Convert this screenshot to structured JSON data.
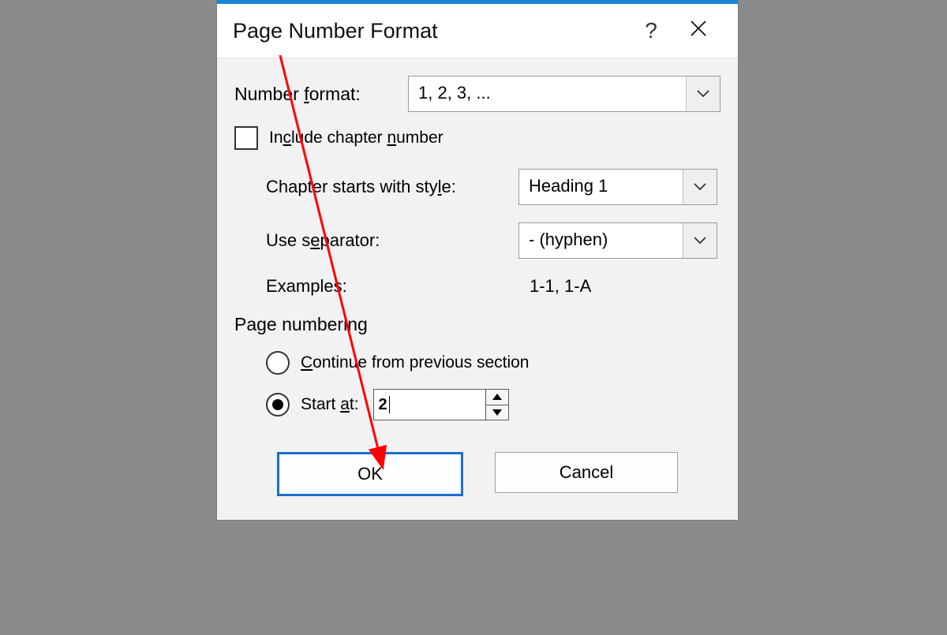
{
  "dialog": {
    "title": "Page Number Format",
    "number_format_label_prefix": "Number ",
    "number_format_label_u": "f",
    "number_format_label_suffix": "ormat:",
    "number_format_value": "1, 2, 3, ...",
    "include_chapter_prefix": "In",
    "include_chapter_u": "c",
    "include_chapter_suffix": "lude chapter ",
    "include_chapter_u2": "n",
    "include_chapter_suffix2": "umber",
    "chapter_style_label_prefix": "Chapter starts with sty",
    "chapter_style_label_u": "l",
    "chapter_style_label_suffix": "e:",
    "chapter_style_value": "Heading 1",
    "separator_label_prefix": "Use s",
    "separator_label_u": "e",
    "separator_label_suffix": "parator:",
    "separator_value": "-   (hyphen)",
    "examples_label": "Examples:",
    "examples_value": "1-1, 1-A",
    "page_numbering_prefix": "Page numberin",
    "page_numbering_u": "g",
    "continue_prefix": "",
    "continue_u": "C",
    "continue_suffix": "ontinue from previous section",
    "startat_prefix": "Start ",
    "startat_u": "a",
    "startat_suffix": "t:",
    "startat_value": "2",
    "ok": "OK",
    "cancel": "Cancel"
  }
}
